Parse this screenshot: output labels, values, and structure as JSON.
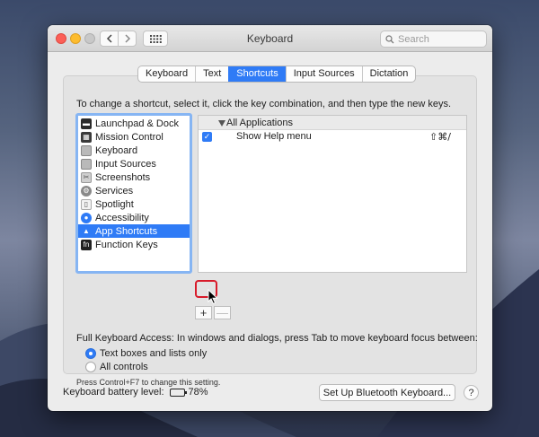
{
  "window": {
    "title": "Keyboard",
    "search_placeholder": "Search"
  },
  "tabs": [
    {
      "label": "Keyboard",
      "active": false
    },
    {
      "label": "Text",
      "active": false
    },
    {
      "label": "Shortcuts",
      "active": true
    },
    {
      "label": "Input Sources",
      "active": false
    },
    {
      "label": "Dictation",
      "active": false
    }
  ],
  "instructions": "To change a shortcut, select it, click the key combination, and then type the new keys.",
  "categories": [
    {
      "label": "Launchpad & Dock",
      "icon": "launchpad-icon",
      "color": "#2b2b2b",
      "selected": false
    },
    {
      "label": "Mission Control",
      "icon": "mission-control-icon",
      "color": "#3a3a3a",
      "selected": false
    },
    {
      "label": "Keyboard",
      "icon": "keyboard-icon",
      "color": "#b9b9b9",
      "selected": false
    },
    {
      "label": "Input Sources",
      "icon": "input-sources-icon",
      "color": "#b9b9b9",
      "selected": false
    },
    {
      "label": "Screenshots",
      "icon": "screenshots-icon",
      "color": "#cfcfcf",
      "selected": false
    },
    {
      "label": "Services",
      "icon": "gear-icon",
      "color": "#8a8a8a",
      "selected": false
    },
    {
      "label": "Spotlight",
      "icon": "spotlight-icon",
      "color": "#9a9a9a",
      "selected": false
    },
    {
      "label": "Accessibility",
      "icon": "accessibility-icon",
      "color": "#2f7bf6",
      "selected": false
    },
    {
      "label": "App Shortcuts",
      "icon": "app-shortcuts-icon",
      "color": "#ffffff",
      "selected": true
    },
    {
      "label": "Function Keys",
      "icon": "function-keys-icon",
      "color": "#222222",
      "selected": false
    }
  ],
  "shortcuts": {
    "group": "All Applications",
    "rows": [
      {
        "name": "Show Help menu",
        "keys": "⇧⌘/",
        "enabled": true
      }
    ]
  },
  "buttons": {
    "add": "+",
    "remove": "—",
    "bluetooth": "Set Up Bluetooth Keyboard...",
    "help": "?"
  },
  "full_keyboard_access": {
    "label": "Full Keyboard Access: In windows and dialogs, press Tab to move keyboard focus between:",
    "options": [
      {
        "label": "Text boxes and lists only",
        "selected": true
      },
      {
        "label": "All controls",
        "selected": false
      }
    ],
    "note": "Press Control+F7 to change this setting."
  },
  "battery": {
    "label": "Keyboard battery level:",
    "value": "78%",
    "level": 0.78
  },
  "colors": {
    "accent": "#2f7bf6",
    "highlight": "#d81b2b"
  }
}
